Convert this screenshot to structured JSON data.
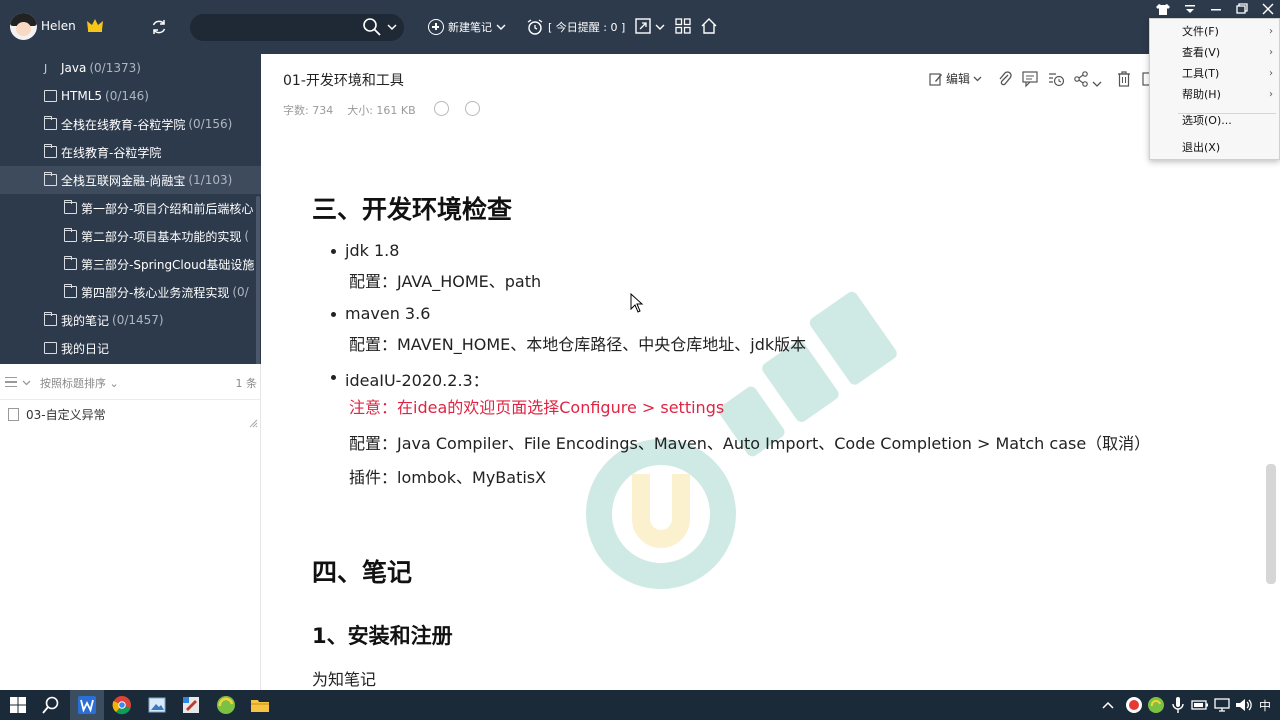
{
  "header": {
    "username": "Helen",
    "new_note_label": "新建笔记",
    "reminder_label": "[ 今日提醒 : 0 ]"
  },
  "sidebar": {
    "items": [
      {
        "label": "Java",
        "count": "(0/1373)",
        "icon": "notebook-icon",
        "level": 1
      },
      {
        "label": "HTML5",
        "count": "(0/146)",
        "icon": "notebook-icon",
        "level": 1
      },
      {
        "label": "全栈在线教育-谷粒学院",
        "count": "(0/156)",
        "icon": "folder-icon",
        "level": 1
      },
      {
        "label": "在线教育-谷粒学院",
        "count": "",
        "icon": "folder-icon",
        "level": 1
      },
      {
        "label": "全栈互联网金融-尚融宝",
        "count": "(1/103)",
        "icon": "folder-icon",
        "level": 1
      },
      {
        "label": "第一部分-项目介绍和前后端核心",
        "count": "",
        "icon": "folder-icon",
        "level": 2
      },
      {
        "label": "第二部分-项目基本功能的实现",
        "count": "(",
        "icon": "folder-icon",
        "level": 2
      },
      {
        "label": "第三部分-SpringCloud基础设施",
        "count": "",
        "icon": "folder-icon",
        "level": 2
      },
      {
        "label": "第四部分-核心业务流程实现",
        "count": "(0/",
        "icon": "folder-icon",
        "level": 2
      },
      {
        "label": "我的笔记",
        "count": "(0/1457)",
        "icon": "folder-icon",
        "level": 1
      },
      {
        "label": "我的日记",
        "count": "",
        "icon": "diary-icon",
        "level": 1
      }
    ]
  },
  "notelist": {
    "sort_label": "按照标题排序",
    "count": "1 条",
    "notes": [
      {
        "title": "03-自定义异常"
      }
    ]
  },
  "note": {
    "title": "01-开发环境和工具",
    "word_count": "字数: 734",
    "size": "大小: 161 KB",
    "edit_label": "编辑",
    "sections": {
      "h_env": "三、开发环境检查",
      "jdk": "jdk 1.8",
      "jdk_config": "配置：JAVA_HOME、path",
      "maven": "maven 3.6",
      "maven_config": "配置：MAVEN_HOME、本地仓库路径、中央仓库地址、jdk版本",
      "idea": "ideaIU-2020.2.3：",
      "idea_note": "注意：在idea的欢迎页面选择Configure > settings",
      "idea_config": "配置：Java Compiler、File Encodings、Maven、Auto Import、Code Completion > Match case（取消）",
      "idea_plugins": "插件：lombok、MyBatisX",
      "h_notes": "四、笔记",
      "h_install": "1、安装和注册",
      "para_weizhi": "为知笔记"
    }
  },
  "menu": {
    "items": [
      {
        "label": "文件(F)",
        "has_submenu": true
      },
      {
        "label": "查看(V)",
        "has_submenu": true
      },
      {
        "label": "工具(T)",
        "has_submenu": true
      },
      {
        "label": "帮助(H)",
        "has_submenu": true
      },
      {
        "label": "选项(O)...",
        "has_submenu": false
      },
      {
        "label": "退出(X)",
        "has_submenu": false
      }
    ],
    "submenu_arrow": "›"
  },
  "taskbar": {
    "ime": "中"
  },
  "colors": {
    "sidebar_bg": "#2d3a4b",
    "accent_red": "#e02443",
    "taskbar_bg": "#1b2a38"
  }
}
